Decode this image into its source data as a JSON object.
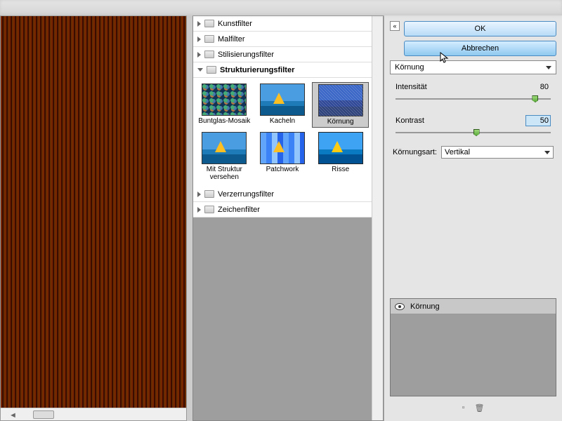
{
  "buttons": {
    "ok": "OK",
    "cancel": "Abbrechen"
  },
  "categories": [
    {
      "label": "Kunstfilter"
    },
    {
      "label": "Malfilter"
    },
    {
      "label": "Stilisierungsfilter"
    },
    {
      "label": "Strukturierungsfilter",
      "open": true
    },
    {
      "label": "Verzerrungsfilter"
    },
    {
      "label": "Zeichenfilter"
    }
  ],
  "thumbs": [
    {
      "label": "Buntglas-Mosaik"
    },
    {
      "label": "Kacheln"
    },
    {
      "label": "Körnung",
      "selected": true
    },
    {
      "label": "Mit Struktur versehen"
    },
    {
      "label": "Patchwork"
    },
    {
      "label": "Risse"
    }
  ],
  "filterDropdown": "Körnung",
  "params": {
    "intensity": {
      "label": "Intensität",
      "value": "80",
      "pos": 88
    },
    "contrast": {
      "label": "Kontrast",
      "value": "50",
      "pos": 50
    }
  },
  "grainType": {
    "label": "Körnungsart:",
    "value": "Vertikal"
  },
  "layer": {
    "name": "Körnung"
  }
}
